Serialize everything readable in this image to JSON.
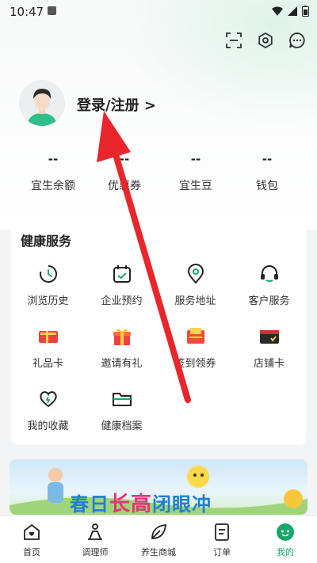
{
  "status_bar": {
    "time": "10:47"
  },
  "header": {
    "icons": [
      "scan-icon",
      "settings-icon",
      "message-icon"
    ]
  },
  "profile": {
    "login_text": "登录/注册 >"
  },
  "stats": [
    {
      "value": "--",
      "label": "宜生余额"
    },
    {
      "value": "--",
      "label": "优惠券"
    },
    {
      "value": "--",
      "label": "宜生豆"
    },
    {
      "value": "--",
      "label": "钱包"
    }
  ],
  "health_services": {
    "title": "健康服务",
    "items": [
      {
        "label": "浏览历史",
        "icon": "history-icon"
      },
      {
        "label": "企业预约",
        "icon": "calendar-icon"
      },
      {
        "label": "服务地址",
        "icon": "location-icon"
      },
      {
        "label": "客户服务",
        "icon": "headset-icon"
      },
      {
        "label": "礼品卡",
        "icon": "gift-card-icon"
      },
      {
        "label": "邀请有礼",
        "icon": "gift-box-icon"
      },
      {
        "label": "签到领券",
        "icon": "checkin-coupon-icon"
      },
      {
        "label": "店铺卡",
        "icon": "store-card-icon"
      },
      {
        "label": "我的收藏",
        "icon": "heart-icon"
      },
      {
        "label": "健康档案",
        "icon": "folder-icon"
      }
    ]
  },
  "banner": {
    "text_a": "春日",
    "text_b": "长高",
    "text_c": "闭眼冲"
  },
  "bottom_nav": {
    "items": [
      {
        "label": "首页",
        "icon": "home-icon"
      },
      {
        "label": "调理师",
        "icon": "therapist-icon"
      },
      {
        "label": "养生商城",
        "icon": "leaf-icon"
      },
      {
        "label": "订单",
        "icon": "order-icon"
      },
      {
        "label": "我的",
        "icon": "profile-icon",
        "active": true
      }
    ]
  },
  "colors": {
    "accent": "#1aa76a",
    "arrow": "#e8262b",
    "banner_blue": "#1f7fd1",
    "banner_pink": "#e6337a"
  }
}
